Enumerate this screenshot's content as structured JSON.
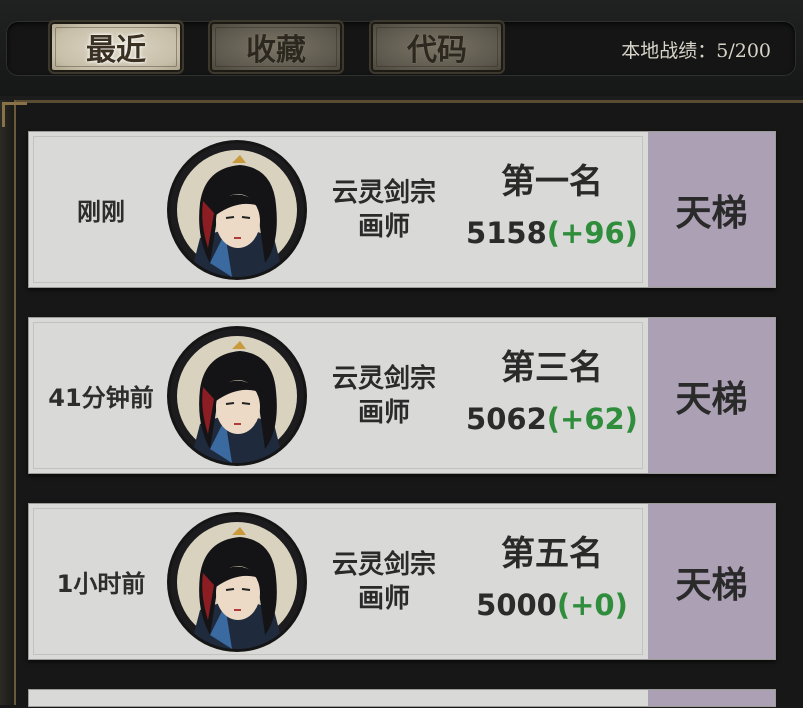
{
  "tabs": [
    {
      "label": "最近",
      "active": true
    },
    {
      "label": "收藏",
      "active": false
    },
    {
      "label": "代码",
      "active": false
    }
  ],
  "record": "本地战绩：5/200",
  "colors": {
    "delta_green": "#2f8d3c",
    "mode_purple": "#aca0b4",
    "card_bg": "#d9d9d7"
  },
  "matches": [
    {
      "time": "刚刚",
      "sect": "云灵剑宗",
      "role": "画师",
      "rank": "第一名",
      "score": "5158",
      "delta": "(+96)",
      "mode": "天梯"
    },
    {
      "time": "41分钟前",
      "sect": "云灵剑宗",
      "role": "画师",
      "rank": "第三名",
      "score": "5062",
      "delta": "(+62)",
      "mode": "天梯"
    },
    {
      "time": "1小时前",
      "sect": "云灵剑宗",
      "role": "画师",
      "rank": "第五名",
      "score": "5000",
      "delta": "(+0)",
      "mode": "天梯"
    }
  ]
}
